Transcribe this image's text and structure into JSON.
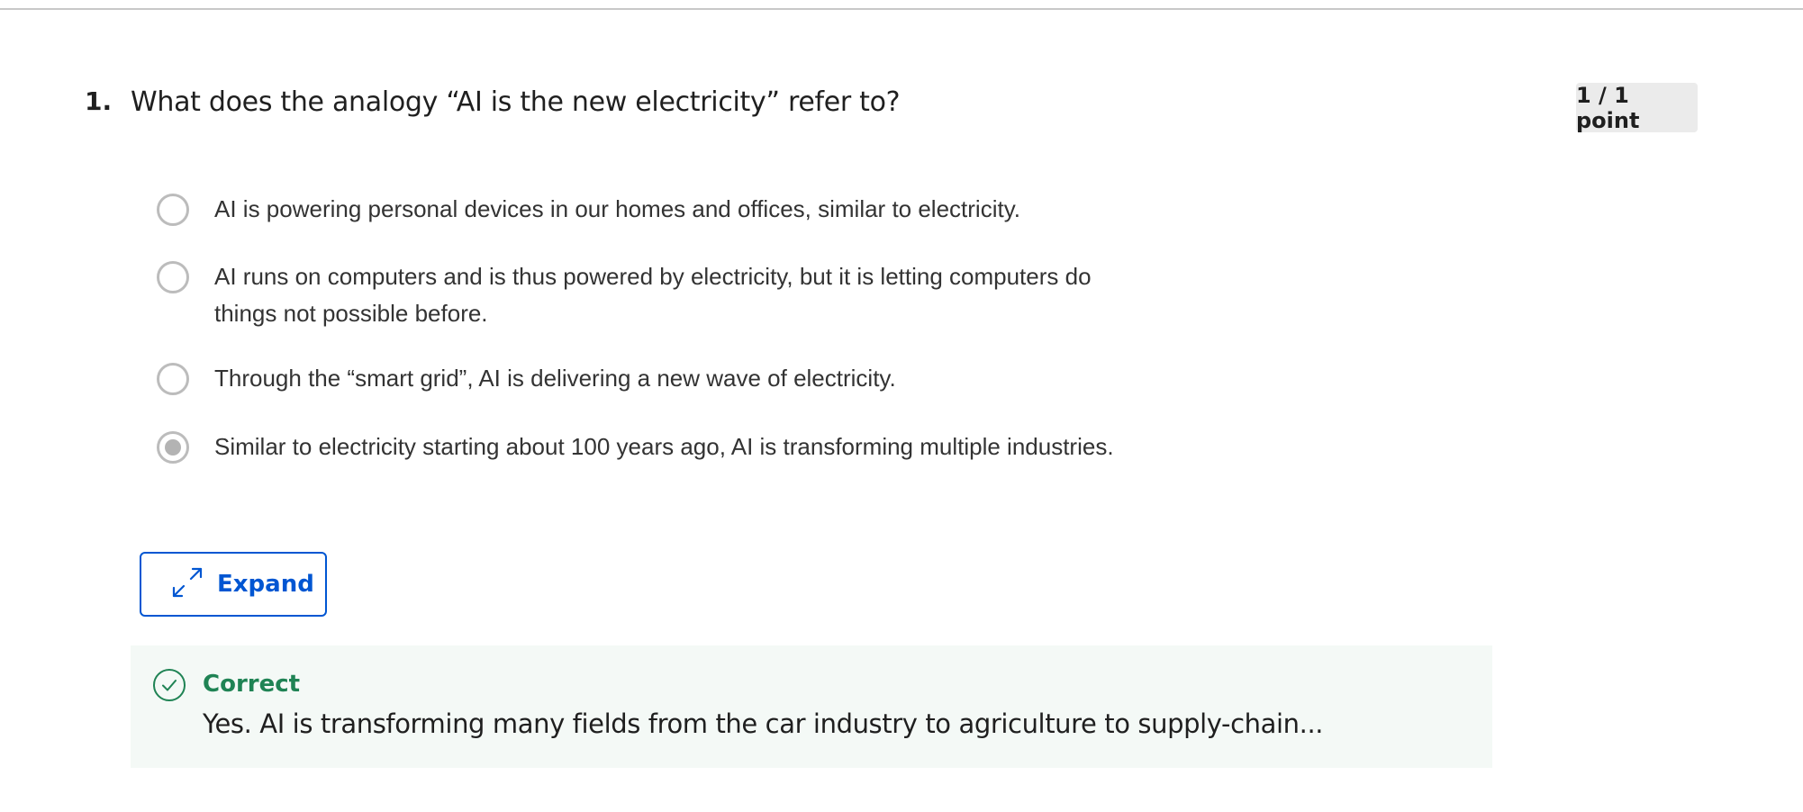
{
  "question": {
    "number": "1.",
    "text": "What does the analogy “AI is the new electricity” refer to?",
    "points": "1 / 1 point"
  },
  "options": [
    {
      "line1": "AI is powering personal devices in our homes and offices, similar to electricity.",
      "line2": "",
      "selected": false
    },
    {
      "line1": "AI runs on computers and is thus powered by electricity, but it is letting computers do",
      "line2": "things not possible before.",
      "selected": false
    },
    {
      "line1": "Through the “smart grid”, AI is delivering a new wave of electricity.",
      "line2": "",
      "selected": false
    },
    {
      "line1": "Similar to electricity starting about 100 years ago, AI is transforming multiple industries.",
      "line2": "",
      "selected": true
    }
  ],
  "expand_button": {
    "label": "Expand",
    "icon": "expand-arrows-icon"
  },
  "feedback": {
    "status": "Correct",
    "icon": "check-circle-icon",
    "text": "Yes. AI is transforming many fields from the car industry to agriculture to supply-chain...",
    "color": "#1f8354"
  },
  "colors": {
    "accent": "#0056d2",
    "success": "#1f8354",
    "badge_bg": "#ebebeb",
    "feedback_bg": "#f4f9f6"
  }
}
